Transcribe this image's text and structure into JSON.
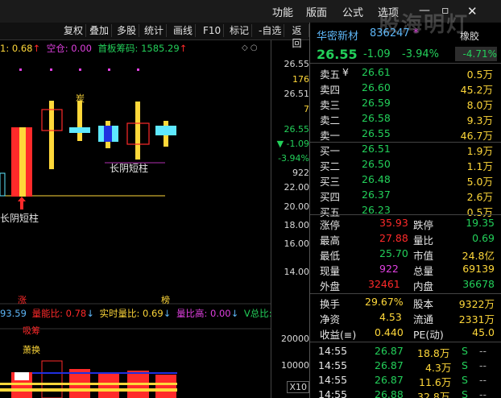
{
  "menu": {
    "items": [
      "功能",
      "版面",
      "公式",
      "选项"
    ]
  },
  "toolbar": {
    "buttons": [
      "复权",
      "叠加",
      "多股",
      "统计",
      "画线",
      "F10",
      "标记",
      "-自选",
      "返回"
    ]
  },
  "indicator_line": {
    "prefix": "1: 0.68",
    "prefix_arrow": "↑",
    "kongcang": "空仓: 0.00",
    "shouban": "首板筹码: 1585.29",
    "shouban_arrow": "↑"
  },
  "y_axis": {
    "labels": [
      "26.55",
      "176",
      "26.51",
      "7",
      "26.55",
      "▼ -1.09",
      "-3.94%",
      "922",
      "22.00",
      "20.00",
      "18.00",
      "16.00",
      "14.00"
    ]
  },
  "annotations": {
    "xing": "炭",
    "changyin1": "长阴短柱",
    "changyin2": "长阴短柱",
    "zhang": "涨",
    "bang": "榜",
    "xichou": "吸筹",
    "huanshou": "萧换"
  },
  "sub_indicator": {
    "v1": "93.59",
    "lianbi": "量能比: 0.78",
    "lianbi_arrow": "↓",
    "shishi": "实时量比: 0.69",
    "shishi_arrow": "↓",
    "lianbigao": "量比高: 0.00",
    "lianbigao_arrow": "↓",
    "vzong": "V总比:"
  },
  "vol_axis": {
    "labels": [
      "20000",
      "10000"
    ],
    "x10": "X10"
  },
  "stock": {
    "name": "华密新材",
    "code": "836247",
    "star": "*",
    "shengzheng": "橡胶",
    "price": "26.55",
    "change": "-1.09",
    "pct": "-3.94%",
    "side_pct": "-4.71%"
  },
  "asks": [
    {
      "label": "卖五",
      "mark": "¥",
      "price": "26.61",
      "vol": "0.5万"
    },
    {
      "label": "卖四",
      "mark": "",
      "price": "26.60",
      "vol": "45.2万"
    },
    {
      "label": "卖三",
      "mark": "",
      "price": "26.59",
      "vol": "8.0万"
    },
    {
      "label": "卖二",
      "mark": "",
      "price": "26.58",
      "vol": "9.3万"
    },
    {
      "label": "卖一",
      "mark": "",
      "price": "26.55",
      "vol": "46.7万"
    }
  ],
  "bids": [
    {
      "label": "买一",
      "price": "26.51",
      "vol": "1.9万"
    },
    {
      "label": "买二",
      "price": "26.50",
      "vol": "1.1万"
    },
    {
      "label": "买三",
      "price": "26.48",
      "vol": "5.0万"
    },
    {
      "label": "买四",
      "price": "26.37",
      "vol": "2.6万"
    },
    {
      "label": "买五",
      "price": "26.23",
      "vol": "0.5万"
    }
  ],
  "info": [
    [
      "涨停",
      "35.93",
      "跌停",
      "19.35"
    ],
    [
      "最高",
      "27.88",
      "量比",
      "0.69"
    ],
    [
      "最低",
      "25.70",
      "市值",
      "24.8亿"
    ],
    [
      "现量",
      "922",
      "总量",
      "69139"
    ],
    [
      "外盘",
      "32461",
      "内盘",
      "36678"
    ]
  ],
  "info2": [
    [
      "换手",
      "29.67%",
      "股本",
      "9322万"
    ],
    [
      "净资",
      "4.53",
      "流通",
      "2331万"
    ],
    [
      "收益(≡)",
      "0.440",
      "PE(动)",
      "45.0"
    ]
  ],
  "ticks": [
    {
      "time": "14:55",
      "price": "26.87",
      "vol": "18.8万",
      "side": "S",
      "extra": "--"
    },
    {
      "time": "14:55",
      "price": "26.87",
      "vol": "4.3万",
      "side": "S",
      "extra": "--"
    },
    {
      "time": "14:55",
      "price": "26.87",
      "vol": "11.6万",
      "side": "S",
      "extra": "--"
    },
    {
      "time": "14:55",
      "price": "26.88",
      "vol": "32.8万",
      "side": "S",
      "extra": "--"
    }
  ],
  "watermark": "股海明灯",
  "colors": {
    "red": "#ff2a2a",
    "green": "#23d05a",
    "yellow": "#ffd83a",
    "blue": "#5db5f5",
    "cyan": "#5ee8ff",
    "magenta": "#e040e0"
  }
}
